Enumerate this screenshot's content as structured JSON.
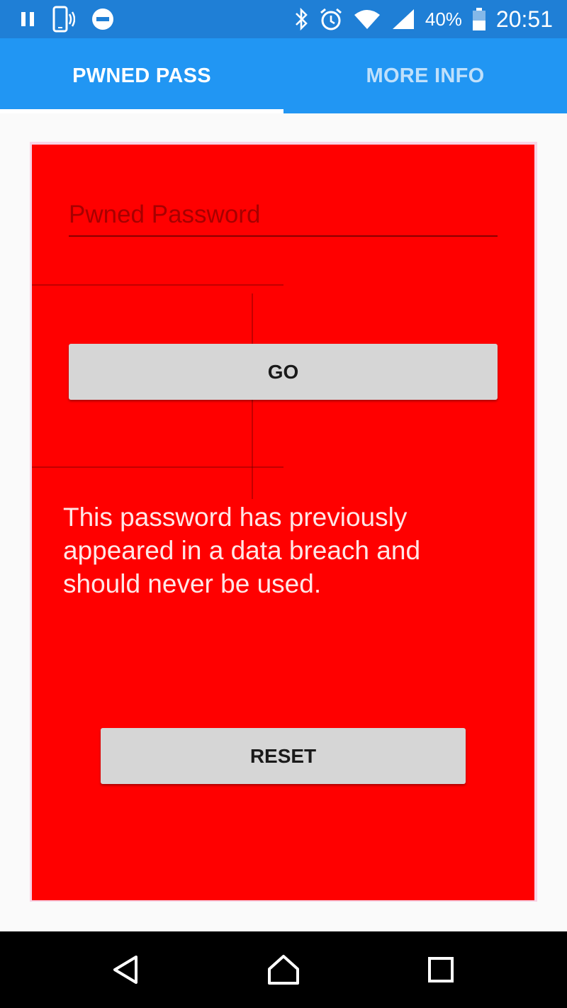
{
  "status_bar": {
    "battery_percent": "40%",
    "time": "20:51",
    "icons": [
      "pause-icon",
      "phone-vibrate-icon",
      "do-not-disturb-icon",
      "bluetooth-icon",
      "alarm-icon",
      "wifi-icon",
      "signal-icon",
      "battery-icon"
    ]
  },
  "tabs": [
    {
      "label": "PWNED PASS",
      "active": true
    },
    {
      "label": "MORE INFO",
      "active": false
    }
  ],
  "form": {
    "background_color": "#ff0000",
    "password_placeholder": "Pwned Password",
    "password_value": "",
    "go_label": "GO",
    "message": "This password has previously appeared in a data breach and should never be used.",
    "reset_label": "RESET"
  },
  "nav_bar": {
    "icons": [
      "back-icon",
      "home-icon",
      "recents-icon"
    ]
  }
}
